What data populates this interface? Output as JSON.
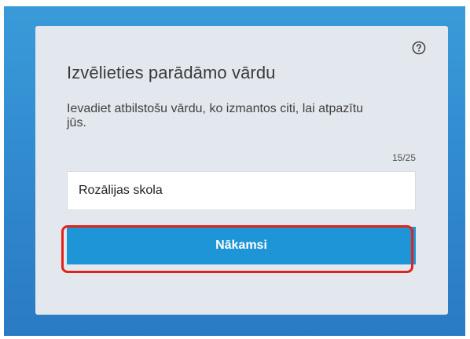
{
  "dialog": {
    "title": "Izvēlieties parādāmo vārdu",
    "description": "Ievadiet atbilstošu vārdu, ko izmantos citi, lai atpazītu jūs.",
    "char_counter": "15/25",
    "name_input": {
      "value": "Rozālijas skola"
    },
    "next_button_label": "Nākamsi",
    "help_icon": "question-circle-icon"
  },
  "colors": {
    "backdrop": "#2f86cc",
    "dialog_background": "#e3e8ee",
    "button_accent": "#1e95d6",
    "highlight": "#e2231a"
  }
}
